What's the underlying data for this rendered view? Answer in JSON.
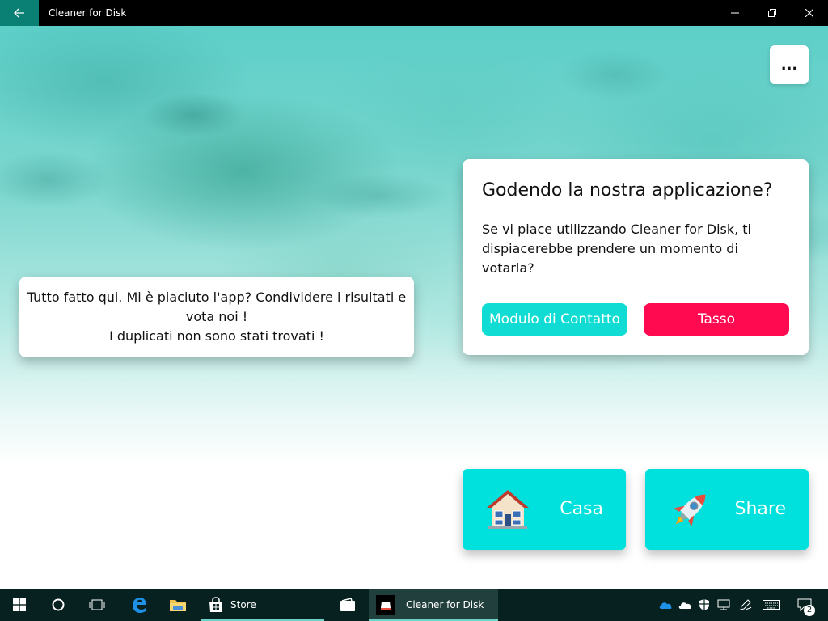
{
  "window": {
    "title": "Cleaner for Disk",
    "back_icon": "back-arrow-icon",
    "minimize_icon": "minimize-icon",
    "maximize_icon": "restore-icon",
    "close_icon": "close-icon"
  },
  "more_button": {
    "label": "..."
  },
  "message_card": {
    "text": "Tutto fatto qui. Mi è piaciuto l'app? Condividere i risultati e vota noi !\nI duplicati non sono stati trovati !"
  },
  "rate_dialog": {
    "title": "Godendo la nostra applicazione?",
    "body": "Se vi piace utilizzando Cleaner for Disk, ti dispiacerebbe prendere un momento di votarla?",
    "contact_button": "Modulo di Contatto",
    "rate_button": "Tasso",
    "colors": {
      "contact": "#10dcd4",
      "rate": "#ff0a50"
    }
  },
  "actions": {
    "home": {
      "label": "Casa",
      "icon": "house-icon"
    },
    "share": {
      "label": "Share",
      "icon": "rocket-icon"
    },
    "color": "#00e0dc"
  },
  "taskbar": {
    "store_label": "Store",
    "active_app_label": "Cleaner for Disk",
    "notification_count": "2"
  }
}
